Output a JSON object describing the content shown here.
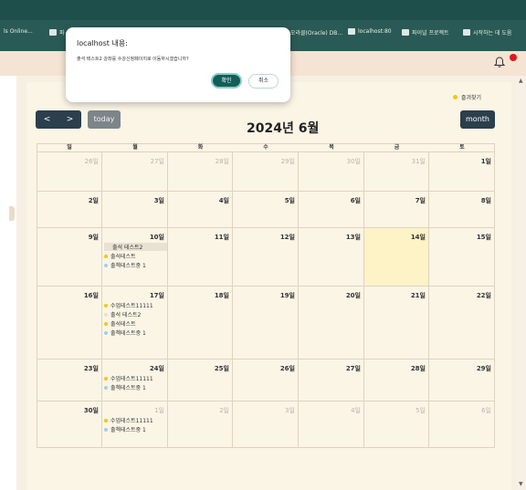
{
  "browser": {
    "bookmarks": [
      {
        "label": "ls Online..."
      },
      {
        "label": "파"
      },
      {
        "label": "오라클(Oracle) DB..."
      },
      {
        "label": "localhost:80"
      },
      {
        "label": "파이널 프로젝트"
      },
      {
        "label": "시작하는 데 도움"
      }
    ]
  },
  "dialog": {
    "title": "localhost 내용:",
    "message": "출석 테스트2 강좌를 수강신청페이지로 이동하시겠습니까?",
    "ok_label": "확인",
    "cancel_label": "취소"
  },
  "toolbar": {
    "prev_label": "<",
    "next_label": ">",
    "today_label": "today",
    "month_label": "month",
    "favorites_label": "즐겨찾기"
  },
  "calendar": {
    "title": "2024년 6월",
    "weekdays": [
      "일",
      "월",
      "화",
      "수",
      "목",
      "금",
      "토"
    ],
    "weeks": [
      [
        "26일",
        "27일",
        "28일",
        "29일",
        "30일",
        "31일",
        "1일"
      ],
      [
        "2일",
        "3일",
        "4일",
        "5일",
        "6일",
        "7일",
        "8일"
      ],
      [
        "9일",
        "10일",
        "11일",
        "12일",
        "13일",
        "14일",
        "15일"
      ],
      [
        "16일",
        "17일",
        "18일",
        "19일",
        "20일",
        "21일",
        "22일"
      ],
      [
        "23일",
        "24일",
        "25일",
        "26일",
        "27일",
        "28일",
        "29일"
      ],
      [
        "30일",
        "1일",
        "2일",
        "3일",
        "4일",
        "5일",
        "6일"
      ]
    ],
    "events": [
      {
        "week": 2,
        "day": 1,
        "label": "출석 테스트2",
        "color": "#e8e2d3",
        "boxed": true
      },
      {
        "week": 2,
        "day": 1,
        "label": "출석테스트",
        "color": "#f5c518"
      },
      {
        "week": 2,
        "day": 1,
        "label": "출첵테스트중 1",
        "color": "#9fd0ee"
      },
      {
        "week": 3,
        "day": 1,
        "label": "수업테스트11111",
        "color": "#f5c518"
      },
      {
        "week": 3,
        "day": 1,
        "label": "출석 테스트2",
        "color": "#e8e2d3"
      },
      {
        "week": 3,
        "day": 1,
        "label": "출석테스트",
        "color": "#f5c518"
      },
      {
        "week": 3,
        "day": 1,
        "label": "출첵테스트중 1",
        "color": "#9fd0ee"
      },
      {
        "week": 4,
        "day": 1,
        "label": "수업테스트11111",
        "color": "#f5c518"
      },
      {
        "week": 4,
        "day": 1,
        "label": "출첵테스트중 1",
        "color": "#9fd0ee"
      },
      {
        "week": 5,
        "day": 1,
        "label": "수업테스트11111",
        "color": "#f5c518"
      },
      {
        "week": 5,
        "day": 1,
        "label": "출첵테스트중 1",
        "color": "#9fd0ee"
      }
    ],
    "highlight": {
      "week": 2,
      "day": 5
    }
  },
  "colors": {
    "header_bar": "#1f4f4a",
    "accent": "#125f5a",
    "notification": "#e3151b",
    "today_highlight": "#fdf3c6"
  }
}
